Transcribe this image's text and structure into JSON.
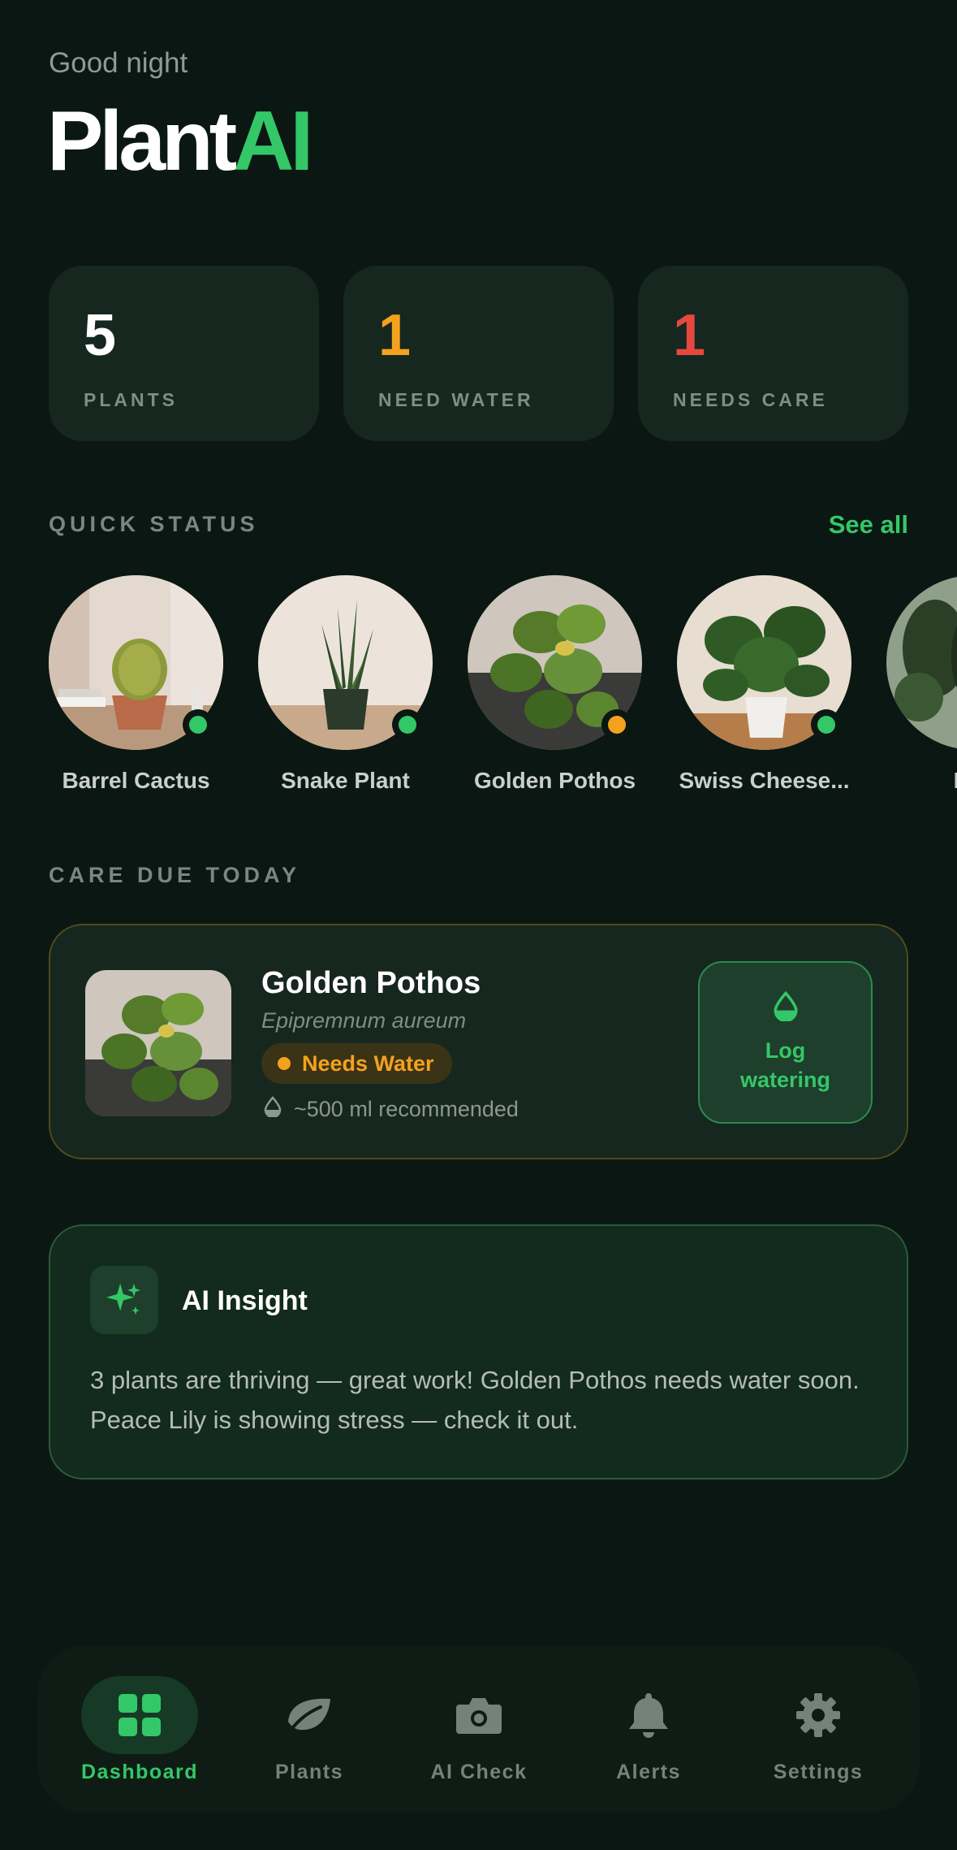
{
  "header": {
    "greeting": "Good night",
    "logo_primary": "Plant",
    "logo_accent": "AI"
  },
  "stats": [
    {
      "value": "5",
      "label": "PLANTS",
      "color": "#ffffff"
    },
    {
      "value": "1",
      "label": "NEED WATER",
      "color": "#f4a21d"
    },
    {
      "value": "1",
      "label": "NEEDS CARE",
      "color": "#e5483f"
    }
  ],
  "quick_status": {
    "title": "QUICK STATUS",
    "see_all": "See all",
    "plants": [
      {
        "name": "Barrel Cactus",
        "status_color": "#34c767"
      },
      {
        "name": "Snake Plant",
        "status_color": "#34c767"
      },
      {
        "name": "Golden Pothos",
        "status_color": "#f4a21d"
      },
      {
        "name": "Swiss Cheese...",
        "status_color": "#34c767"
      },
      {
        "name": "Pea"
      }
    ]
  },
  "care_due": {
    "title": "CARE DUE TODAY",
    "plant_name": "Golden Pothos",
    "scientific_name": "Epipremnum aureum",
    "badge": "Needs Water",
    "recommendation": "~500 ml recommended",
    "action_label": "Log watering"
  },
  "insight": {
    "icon": "sparkles-icon",
    "title": "AI Insight",
    "text": "3 plants are thriving — great work! Golden Pothos needs water soon. Peace Lily is showing stress — check it out."
  },
  "tabs": [
    {
      "label": "Dashboard",
      "icon": "grid-icon",
      "active": true
    },
    {
      "label": "Plants",
      "icon": "leaf-icon"
    },
    {
      "label": "AI Check",
      "icon": "camera-icon"
    },
    {
      "label": "Alerts",
      "icon": "bell-icon"
    },
    {
      "label": "Settings",
      "icon": "gear-icon"
    }
  ],
  "colors": {
    "background": "#0b1712",
    "accent": "#34c767",
    "warning": "#f4a21d",
    "danger": "#e5483f"
  }
}
